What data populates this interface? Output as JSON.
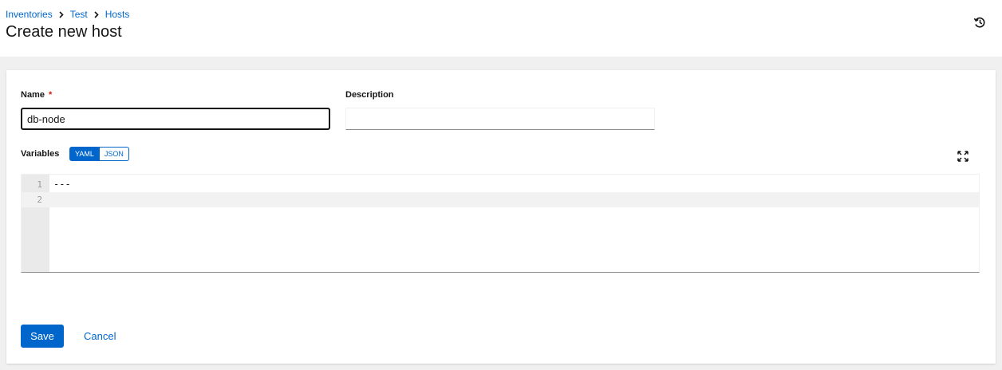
{
  "breadcrumb": {
    "items": [
      {
        "label": "Inventories"
      },
      {
        "label": "Test"
      },
      {
        "label": "Hosts"
      }
    ]
  },
  "header": {
    "title": "Create new host",
    "history_icon": "history-icon"
  },
  "form": {
    "name": {
      "label": "Name",
      "required_mark": "*",
      "value": "db-node"
    },
    "description": {
      "label": "Description",
      "value": ""
    },
    "variables": {
      "label": "Variables",
      "toggle": {
        "yaml_label": "YAML",
        "json_label": "JSON",
        "selected": "YAML"
      },
      "expand_icon": "expand-icon",
      "editor": {
        "lines": [
          {
            "number": "1",
            "text": "---"
          },
          {
            "number": "2",
            "text": ""
          }
        ]
      }
    },
    "actions": {
      "save_label": "Save",
      "cancel_label": "Cancel"
    }
  },
  "colors": {
    "primary": "#0066cc",
    "required": "#c9190b",
    "page_background": "#f0f0f0"
  }
}
